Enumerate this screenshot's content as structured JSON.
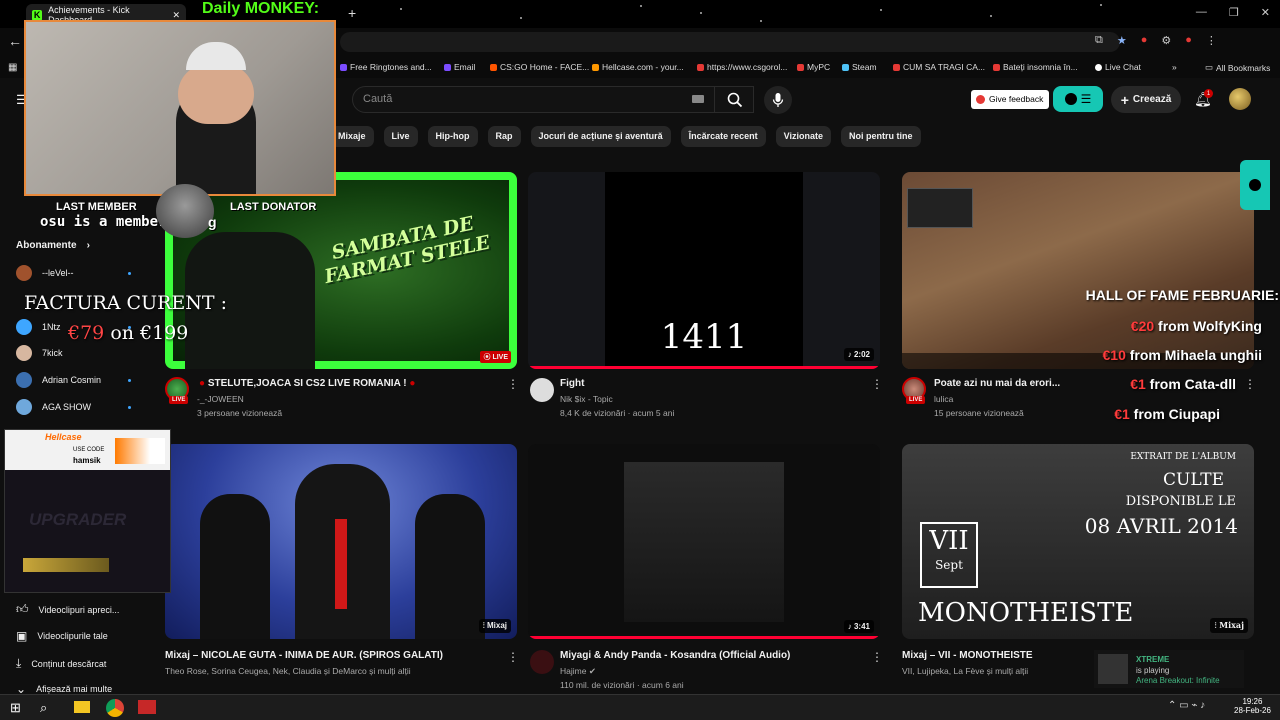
{
  "tab": {
    "title": "Achievements - Kick Dashboard"
  },
  "overlay": {
    "daily_title": "Daily MONKEY:",
    "last_member_label": "LAST MEMBER",
    "last_donator_label": "LAST DONATOR",
    "member_ticker": "osu is a member fo",
    "member_ticker_tail": "g",
    "factura_label": "FACTURA CURENT :",
    "factura_current": "€79",
    "factura_on": "on",
    "factura_target": "€199",
    "hall_of_fame": "HALL OF FAME FEBRUARIE:",
    "donations": [
      {
        "amount": "€20",
        "from": "from WolfyKing"
      },
      {
        "amount": "€10",
        "from": "from Mihaela unghii"
      },
      {
        "amount": "€1",
        "from": "from Cata-dll"
      },
      {
        "amount": "€1",
        "from": "from Ciupapi"
      }
    ],
    "hellcase_brand": "Hellcase",
    "hellcase_user_label": "USE CODE",
    "hellcase_user": "hamsik",
    "hellcase_upgrader": "UPGRADER"
  },
  "bookmarks": [
    {
      "label": "Free Ringtones and...",
      "color": "#7b4cff"
    },
    {
      "label": "Email",
      "color": "#7b4cff"
    },
    {
      "label": "CS:GO Home - FACE...",
      "color": "#ff5500"
    },
    {
      "label": "Hellcase.com - your...",
      "color": "#ff9800"
    },
    {
      "label": "https://www.csgorol...",
      "color": "#e53935"
    },
    {
      "label": "MyPC",
      "color": "#e53935"
    },
    {
      "label": "Steam",
      "color": "#4fc3f7"
    },
    {
      "label": "CUM SA TRAGI CA...",
      "color": "#e53935"
    },
    {
      "label": "Bateți insomnia în...",
      "color": "#e53935"
    },
    {
      "label": "Live Chat",
      "color": "#ffffff"
    }
  ],
  "bookmarks_all": "All Bookmarks",
  "search": {
    "placeholder": "Caută"
  },
  "header": {
    "feedback": "Give feedback",
    "create": "Creează",
    "notif_count": "1"
  },
  "chips": [
    "Mixaje",
    "Live",
    "Hip-hop",
    "Rap",
    "Jocuri de acțiune și aventură",
    "Încărcate recent",
    "Vizionate",
    "Noi pentru tine"
  ],
  "sidebar": {
    "subscriptions_header": "Abonamente",
    "channels": [
      {
        "name": "--leVel--",
        "color": "#a0522d",
        "dot": true
      },
      {
        "name": "1Ntz",
        "color": "#3ea6ff",
        "dot": true
      },
      {
        "name": "7kick",
        "color": "#d7b7a0",
        "dot": false
      },
      {
        "name": "Adrian Cosmin",
        "color": "#3b6fb0",
        "dot": true
      },
      {
        "name": "AGA SHOW",
        "color": "#6fa8dc",
        "dot": true
      }
    ],
    "bottom": [
      {
        "label": "Videoclipuri apreci..."
      },
      {
        "label": "Videoclipurile tale"
      },
      {
        "label": "Conținut descărcat"
      },
      {
        "label": "Afișează mai multe"
      }
    ]
  },
  "videos": [
    {
      "title": "STELUTE,JOACA SI CS2  LIVE ROMANIA !",
      "channel": "-_-JOWEEN",
      "meta": "3 persoane vizionează",
      "badge": "LIVE",
      "thumb_text": "SAMBATA DE FARMAT STELE"
    },
    {
      "title": "Fight",
      "channel": "Nik $ix - Topic",
      "meta": "8,4 K de vizionări · acum 5 ani",
      "duration": "2:02",
      "thumb_text": "1411"
    },
    {
      "title": "Poate azi nu mai da erori...",
      "channel": "lulica",
      "meta": "15 persoane vizionează"
    },
    {
      "title": "Mixaj – NICOLAE GUTA - INIMA DE AUR. (SPIROS GALATI)",
      "channel": "Theo Rose, Sorina Ceugea, Nek, Claudia și DeMarco și mulți alții",
      "badge": "Mixaj"
    },
    {
      "title": "Miyagi & Andy Panda - Kosandra (Official Audio)",
      "channel": "Hajime",
      "meta": "110 mil. de vizionări · acum 6 ani",
      "duration": "3:41"
    },
    {
      "title": "Mixaj – VII - MONOTHEISTE",
      "channel": "VII, Lujipeka, La Fève și mulți alții",
      "badge": "Mixaj",
      "thumb_album": "EXTRAIT DE L'ALBUM",
      "thumb_culte": "CULTE",
      "thumb_dispo": "DISPONIBLE LE",
      "thumb_date": "08 AVRIL 2014",
      "thumb_vii": "VII",
      "thumb_sept": "Sept",
      "thumb_mono": "MONOTHEISTE"
    }
  ],
  "xtreme": {
    "name": "XTREME",
    "status": "is playing",
    "game": "Arena Breakout: Infinite"
  },
  "taskbar": {
    "time": "19:26",
    "date": "28-Feb-26"
  }
}
